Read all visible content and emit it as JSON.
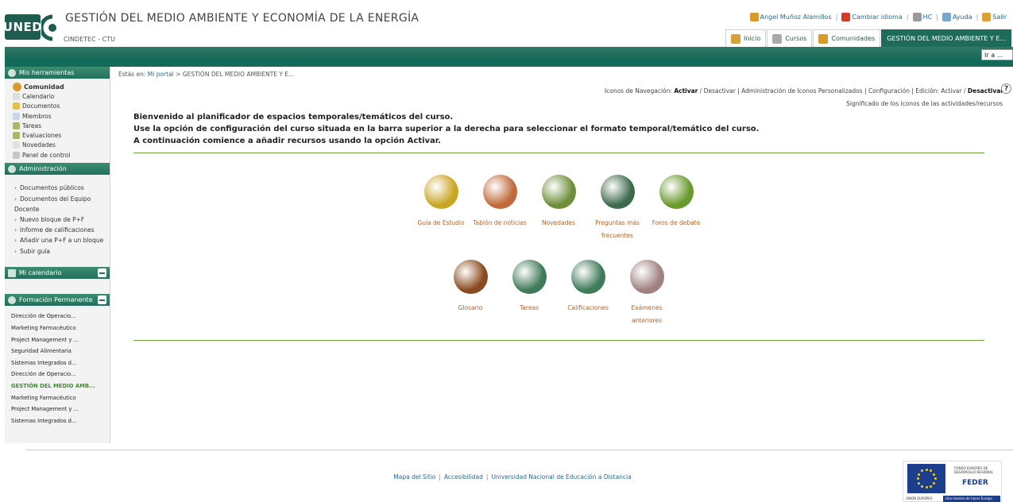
{
  "header": {
    "logo_text": "UNED",
    "site_title": "GESTIÓN DEL MEDIO AMBIENTE Y ECONOMÍA DE LA ENERGÍA",
    "site_sub": "CINDETEC - CTU",
    "user_links": [
      {
        "label": "Angel Muñoz Alamillos",
        "icon": "users-icon",
        "color": "#d79a2b"
      },
      {
        "label": "Cambiar idioma",
        "icon": "language-flag-icon",
        "color": "#d43a2a"
      },
      {
        "label": "HC",
        "icon": "person-icon",
        "color": "#9a9a9a"
      },
      {
        "label": "Ayuda",
        "icon": "help-globe-icon",
        "color": "#7aa6c9"
      },
      {
        "label": "Salir",
        "icon": "exit-icon",
        "color": "#d9a13a"
      }
    ],
    "tabs": [
      {
        "label": "Inicio",
        "icon": "home-icon",
        "color": "#d9a13a"
      },
      {
        "label": "Cursos",
        "icon": "courses-cube-icon",
        "color": "#a9a9a9"
      },
      {
        "label": "Comunidades",
        "icon": "community-icon",
        "color": "#d79a2b"
      },
      {
        "label": "GESTIÓN DEL MEDIO AMBIENTE Y E...",
        "active": true
      }
    ],
    "ir_a": "Ir a ..."
  },
  "sidebar": {
    "tools_title": "Mis herramientas",
    "tools": [
      {
        "label": "Comunidad",
        "bold": true,
        "icon": "community-icon",
        "color": "#d79a2b"
      },
      {
        "label": "Calendario",
        "icon": "calendar-icon",
        "color": "#dddddd"
      },
      {
        "label": "Documentos",
        "icon": "documents-icon",
        "color": "#e3c24a"
      },
      {
        "label": "Miembros",
        "icon": "members-icon",
        "color": "#c8d6e6"
      },
      {
        "label": "Tareas",
        "icon": "tasks-icon",
        "color": "#a7b86a"
      },
      {
        "label": "Evaluaciones",
        "icon": "evaluations-icon",
        "color": "#a7b86a"
      },
      {
        "label": "Novedades",
        "icon": "news-icon",
        "color": "#e0e0e0"
      },
      {
        "label": "Panel de control",
        "icon": "control-panel-icon",
        "color": "#c7c7c7"
      }
    ],
    "admin_title": "Administración",
    "admin": [
      "Documentos públicos",
      "Documentos del Equipo Docente",
      "Nuevo bloque de P+F",
      "Informe de calificaciones",
      "Añadir una P+F a un bloque",
      "Subir guía"
    ],
    "calendar_title": "Mi calendario",
    "fp_title": "Formación Permanente",
    "fp_items": [
      "Dirección de Operacio...",
      "Marketing Farmacéutico",
      "Project Management y ...",
      "Seguridad Alimentaria",
      "Sistemas Integrados d...",
      "Dirección de Operacio...",
      "GESTIÓN DEL MEDIO AMB...",
      "Marketing Farmacéutico",
      "Project Management y ...",
      "Sistemas Integrados d..."
    ],
    "fp_current_index": 6
  },
  "main": {
    "crumb_prefix": "Estás en:",
    "crumb_link": "Mi portal",
    "crumb_rest": "> GESTIÓN DEL MEDIO AMBIENTE Y E...",
    "nav_icons": {
      "label": "Iconos de Navegación:",
      "activar": "Activar",
      "rest": "/ Desactivar | Administración de Iconos Personalizados | Configuración | Edición: Activar /",
      "desactivar": "Desactivar"
    },
    "help": "?",
    "meaning": "Significado de los iconos de las actividades/recursos",
    "welcome": [
      "Bienvenido al planificador de espacios temporales/temáticos del curso.",
      "Use la opción de configuración del curso situada en la barra superior a la derecha para seleccionar el formato temporal/temático del curso.",
      "A continuación comience a añadir recursos usando la opción Activar."
    ],
    "resources_row1": [
      {
        "label": "Guía de Estudio",
        "icon": "study-guide-icon",
        "color": "#c9a524"
      },
      {
        "label": "Tablón de noticias",
        "icon": "news-board-icon",
        "color": "#c0693a"
      },
      {
        "label": "Novedades",
        "icon": "news-icon",
        "color": "#6d8f3a"
      },
      {
        "label": "Preguntas más frecuentes",
        "icon": "faq-icon",
        "color": "#3e6a4c"
      },
      {
        "label": "Foros de debate",
        "icon": "forum-icon",
        "color": "#6a9a2e"
      }
    ],
    "resources_row2": [
      {
        "label": "Glosario",
        "icon": "glossary-icon",
        "color": "#8a4a1f"
      },
      {
        "label": "Tareas",
        "icon": "tasks-icon",
        "color": "#3f7a5a"
      },
      {
        "label": "Calificaciones",
        "icon": "grades-icon",
        "color": "#3f7a5a"
      },
      {
        "label": "Exámenes anteriores",
        "icon": "past-exams-icon",
        "color": "#a08080"
      }
    ]
  },
  "footer": {
    "links": [
      "Mapa del Sitio",
      "Accesibilidad",
      "Universidad Nacional de Educación a Distancia"
    ],
    "feder_top": "FONDO EUROPEO DE DESARROLLO REGIONAL",
    "feder_title": "FEDER",
    "feder_eu": "UNIÓN EUROPEA",
    "feder_slogan": "Una manera de hacer Europa"
  }
}
